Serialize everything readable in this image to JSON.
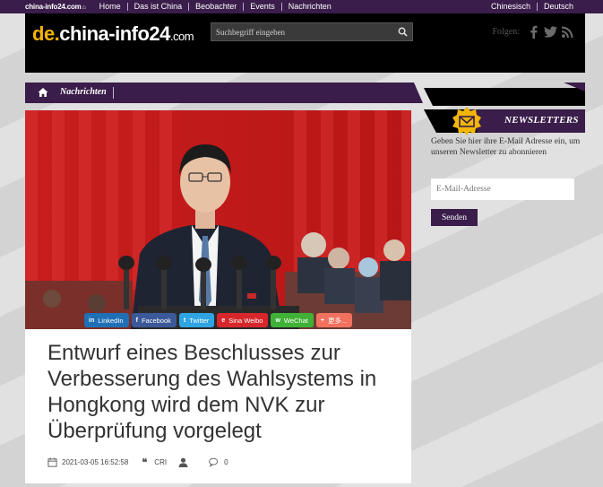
{
  "topbar": {
    "mini_logo": "china-info24.com",
    "nav": [
      "Home",
      "Das ist China",
      "Beobachter",
      "Events",
      "Nachrichten"
    ],
    "languages": [
      "Chinesisch",
      "Deutsch"
    ]
  },
  "header": {
    "logo_prefix": "de.",
    "logo_main": "china-info24",
    "logo_suffix": ".com",
    "search_placeholder": "Suchbegriff eingeben",
    "follow_label": "Folgen:",
    "social_icons": [
      "facebook-icon",
      "twitter-icon",
      "rss-icon"
    ]
  },
  "navbar": {
    "label": "Nachrichten"
  },
  "share_buttons": [
    {
      "label": "LinkedIn",
      "icon": "in",
      "color": "#1f6fb5"
    },
    {
      "label": "Facebook",
      "icon": "f",
      "color": "#3b5998"
    },
    {
      "label": "Twitter",
      "icon": "t",
      "color": "#2ea4e3"
    },
    {
      "label": "Sina Weibo",
      "icon": "e",
      "color": "#d7272c"
    },
    {
      "label": "WeChat",
      "icon": "w",
      "color": "#3fb136"
    },
    {
      "label": "更多...",
      "icon": "+",
      "color": "#f1715e"
    }
  ],
  "article": {
    "headline": "Entwurf eines Beschlusses zur Verbesserung des Wahlsystems in Hongkong wird dem NVK zur Überprüfung vorgelegt",
    "date": "2021-03-05 16:52:58",
    "source": "CRI",
    "comments": "0"
  },
  "newsletter": {
    "title": "NEWSLETTERS",
    "description": "Geben Sie hier ihre E-Mail Adresse ein, um unseren Newsletter zu abonnieren",
    "email_placeholder": "E-Mail-Adresse",
    "submit_label": "Senden"
  },
  "colors": {
    "brand_purple": "#3a1d4a",
    "logo_gold": "#f5b400",
    "badge_gold": "#f2b705"
  }
}
